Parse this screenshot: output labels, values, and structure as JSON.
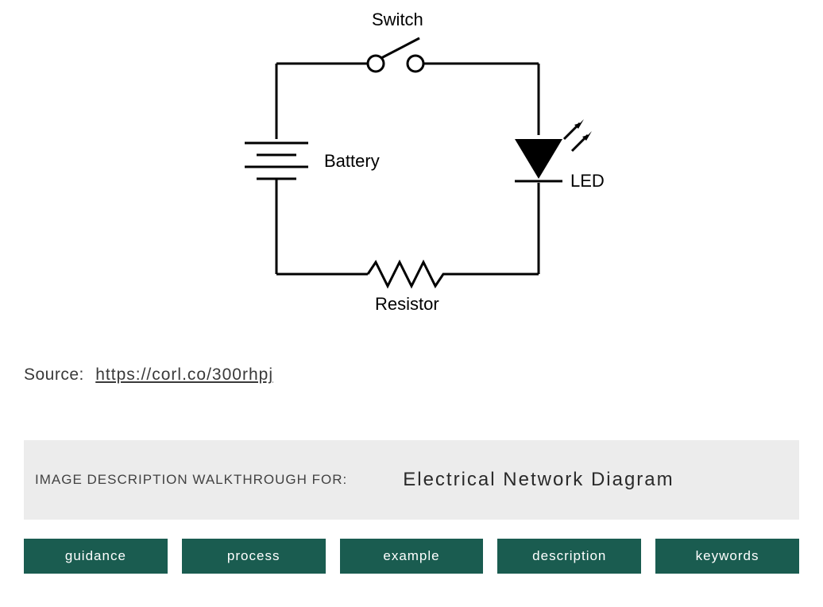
{
  "diagram": {
    "components": {
      "switch": "Switch",
      "battery": "Battery",
      "led": "LED",
      "resistor": "Resistor"
    }
  },
  "source": {
    "label": "Source:",
    "link_text": "https://corl.co/300rhpj"
  },
  "walkthrough": {
    "label": "IMAGE DESCRIPTION WALKTHROUGH FOR:",
    "title": "Electrical Network Diagram"
  },
  "tabs": [
    {
      "label": "guidance"
    },
    {
      "label": "process"
    },
    {
      "label": "example"
    },
    {
      "label": "description"
    },
    {
      "label": "keywords"
    }
  ]
}
